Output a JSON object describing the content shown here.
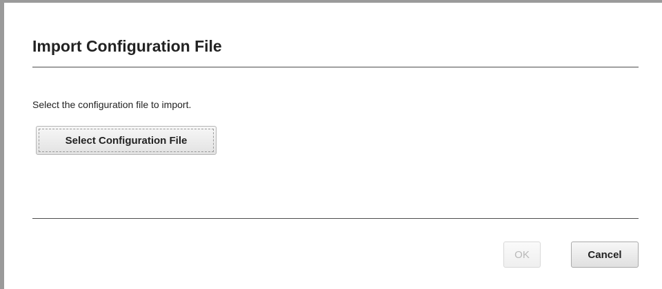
{
  "dialog": {
    "title": "Import Configuration File",
    "instructions": "Select the configuration file to import.",
    "select_button_label": "Select Configuration File",
    "ok_label": "OK",
    "ok_disabled": true,
    "cancel_label": "Cancel"
  }
}
